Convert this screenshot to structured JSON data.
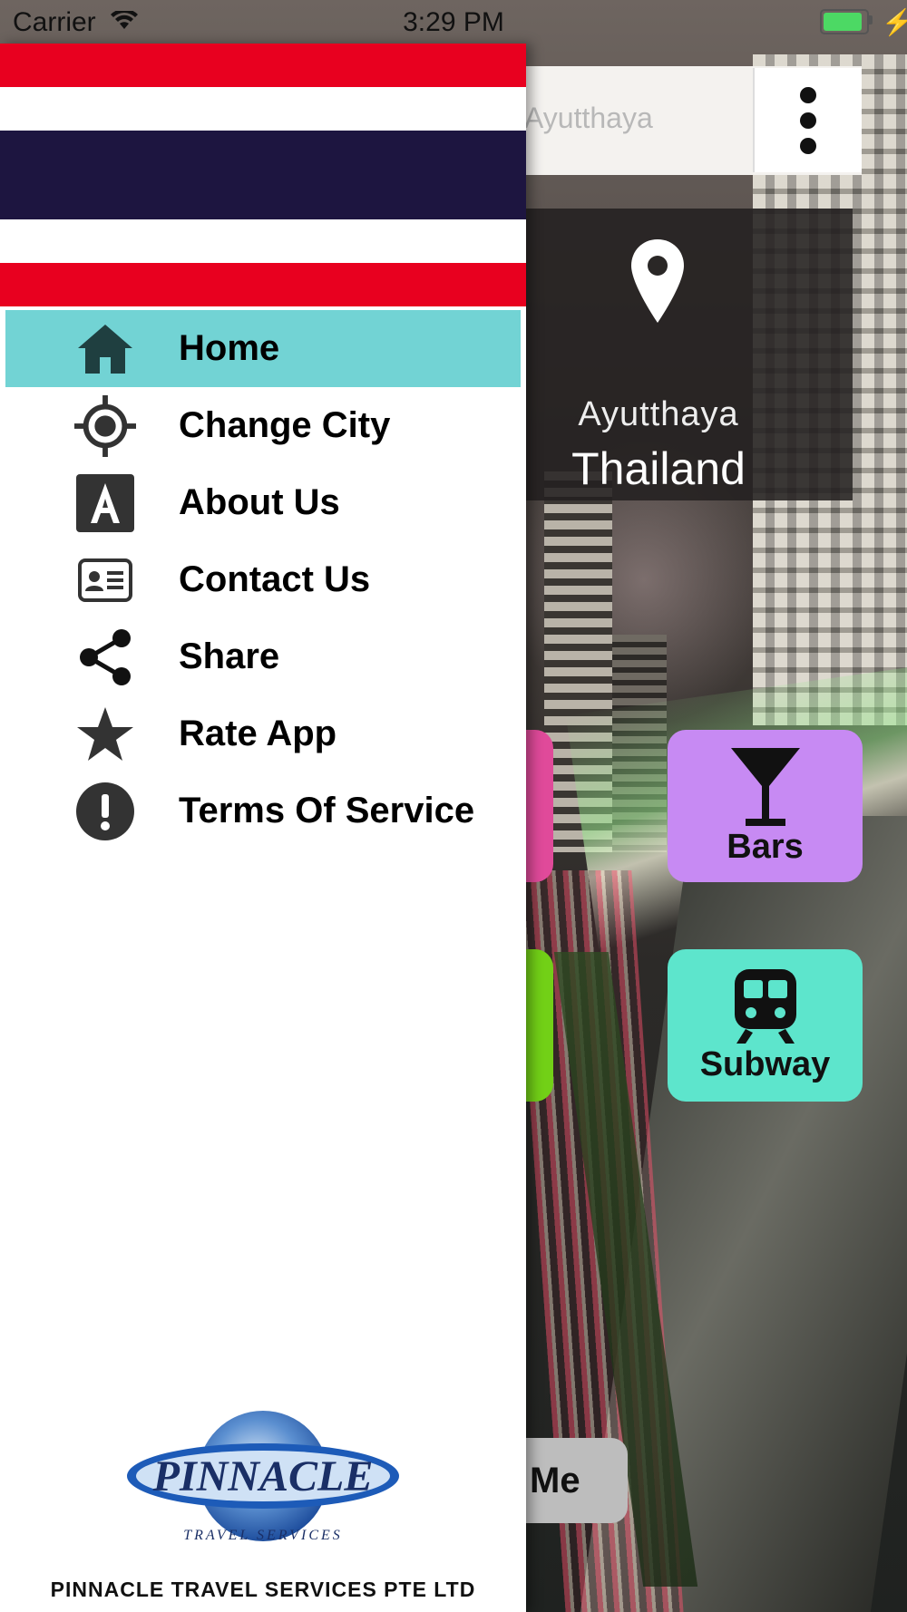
{
  "status_bar": {
    "carrier": "Carrier",
    "time": "3:29 PM",
    "battery_color": "#4cd964"
  },
  "background": {
    "search_placeholder": "Ayutthaya",
    "location": {
      "city": "Ayutthaya",
      "country": "Thailand"
    },
    "tiles": [
      {
        "label": "Bars",
        "icon": "cocktail-glass-icon",
        "color": "#c78af3"
      },
      {
        "label": "Subway",
        "icon": "train-icon",
        "color": "#5de5cc"
      }
    ],
    "partial_button_label": "Me"
  },
  "drawer": {
    "header_flag": "thailand-flag",
    "flag_colors": {
      "red": "#e8001f",
      "white": "#ffffff",
      "blue": "#1d1540"
    },
    "active_color": "#72d3d4",
    "menu": [
      {
        "label": "Home",
        "icon": "home-icon",
        "active": true
      },
      {
        "label": "Change City",
        "icon": "target-icon",
        "active": false
      },
      {
        "label": "About Us",
        "icon": "about-icon",
        "active": false
      },
      {
        "label": "Contact Us",
        "icon": "contact-card-icon",
        "active": false
      },
      {
        "label": "Share",
        "icon": "share-icon",
        "active": false
      },
      {
        "label": "Rate App",
        "icon": "star-icon",
        "active": false
      },
      {
        "label": "Terms Of Service",
        "icon": "alert-icon",
        "active": false
      }
    ],
    "logo": {
      "word": "PINNACLE",
      "tagline": "TRAVEL SERVICES"
    },
    "company_name": "PINNACLE TRAVEL SERVICES PTE LTD"
  }
}
